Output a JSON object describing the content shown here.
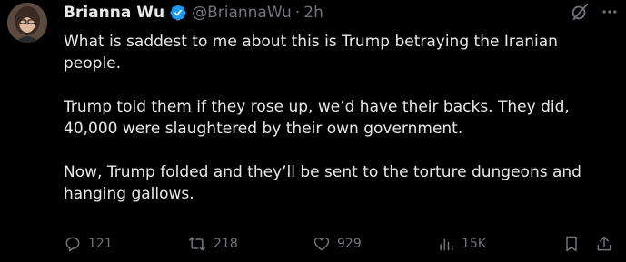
{
  "author": {
    "display_name": "Brianna Wu",
    "handle": "@BriannaWu",
    "separator": "·",
    "time": "2h",
    "verified_color": "#1d9bf0"
  },
  "tweet": {
    "text": "What is saddest to me about this is Trump betraying the Iranian\npeople.\n\nTrump told them if they rose up, we’d have their backs. They did,\n40,000 were slaughtered by their own government.\n\nNow, Trump folded and they’ll be sent to the torture dungeons and\nhanging gallows."
  },
  "actions": {
    "replies": "121",
    "reposts": "218",
    "likes": "929",
    "views": "15K"
  },
  "icons": {
    "top": [
      "grok-icon",
      "more-icon"
    ],
    "bottom": [
      "reply-icon",
      "repost-icon",
      "like-icon",
      "views-icon",
      "bookmark-icon",
      "share-icon"
    ]
  },
  "colors": {
    "background": "#000000",
    "primary_text": "#e7e9ea",
    "secondary_text": "#71767b",
    "accent": "#1d9bf0"
  }
}
